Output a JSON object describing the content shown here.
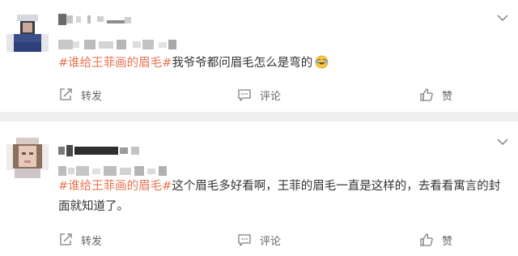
{
  "posts": [
    {
      "hashtag": "#谁给王菲画的眉毛#",
      "text": "我爷爷都问眉毛怎么是弯的",
      "emoji": "laughing-crying-emoji",
      "actions": {
        "repost": "转发",
        "comment": "评论",
        "like": "赞"
      }
    },
    {
      "hashtag": "#谁给王菲画的眉毛#",
      "text": "这个眉毛多好看啊，王菲的眉毛一直是这样的，去看看寓言的封面就知道了。",
      "actions": {
        "repost": "转发",
        "comment": "评论",
        "like": "赞"
      }
    }
  ],
  "colors": {
    "hashtag": "#eb7350",
    "text": "#333333",
    "action": "#666666",
    "separator": "#efefef",
    "icon": "#808080"
  },
  "icons": {
    "more": "chevron-down-icon",
    "repost": "repost-icon",
    "comment": "comment-icon",
    "like": "thumbs-up-icon"
  }
}
